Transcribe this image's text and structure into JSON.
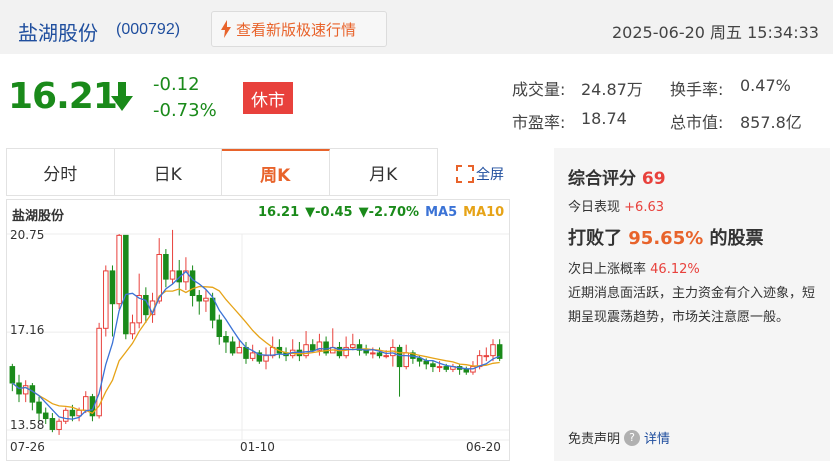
{
  "header": {
    "stock_name": "盐湖股份",
    "stock_code": "(000792)",
    "quick_button_label": "查看新版极速行情",
    "datetime": "2025-06-20 周五 15:34:33"
  },
  "quote": {
    "price": "16.21",
    "change": "-0.12",
    "change_pct": "-0.73%",
    "status": "休市",
    "trend_icon": "down-arrow-icon",
    "volume_label": "成交量:",
    "volume": "24.87万",
    "turnover_label": "换手率:",
    "turnover": "0.47%",
    "pe_label": "市盈率:",
    "pe": "18.74",
    "mcap_label": "总市值:",
    "mcap": "857.8亿"
  },
  "tabs": [
    {
      "label": "分时",
      "active": false
    },
    {
      "label": "日K",
      "active": false
    },
    {
      "label": "周K",
      "active": true
    },
    {
      "label": "月K",
      "active": false
    }
  ],
  "fullscreen_label": "全屏",
  "chart_header": {
    "name": "盐湖股份",
    "last": "16.21",
    "chg": "▼-0.45",
    "chg_pct": "▼-2.70%",
    "ma5_label": "MA5",
    "ma10_label": "MA10"
  },
  "colors": {
    "up": "#e8413c",
    "down": "#1a8a1a",
    "ma5": "#3b73d6",
    "ma10": "#e6a317",
    "accent": "#e8632b",
    "link": "#1f4e9e"
  },
  "chart_data": {
    "type": "candlestick",
    "period": "weekly",
    "ylim": [
      13.58,
      20.75
    ],
    "y_tick_labels": [
      "20.75",
      "17.16",
      "13.58"
    ],
    "x_tick_labels": [
      "07-26",
      "01-10",
      "06-20"
    ],
    "candles": [
      [
        15.9,
        15.3,
        16.0,
        15.0
      ],
      [
        15.3,
        14.9,
        15.6,
        14.6
      ],
      [
        14.9,
        15.2,
        15.4,
        14.6
      ],
      [
        15.2,
        14.6,
        15.3,
        14.3
      ],
      [
        14.6,
        14.2,
        14.8,
        13.9
      ],
      [
        14.2,
        14.0,
        14.4,
        13.8
      ],
      [
        14.0,
        13.6,
        14.2,
        13.5
      ],
      [
        13.6,
        13.9,
        14.0,
        13.4
      ],
      [
        13.9,
        14.3,
        14.4,
        13.8
      ],
      [
        14.3,
        14.1,
        14.5,
        13.9
      ],
      [
        14.1,
        14.3,
        14.4,
        13.9
      ],
      [
        14.3,
        14.8,
        15.0,
        14.2
      ],
      [
        14.8,
        14.1,
        14.9,
        13.9
      ],
      [
        14.1,
        17.3,
        17.5,
        14.0
      ],
      [
        17.3,
        19.4,
        19.6,
        17.0
      ],
      [
        19.4,
        18.2,
        19.6,
        17.0
      ],
      [
        18.2,
        20.7,
        20.75,
        18.0
      ],
      [
        20.7,
        17.1,
        20.7,
        16.9
      ],
      [
        17.1,
        17.5,
        17.8,
        16.9
      ],
      [
        17.5,
        18.5,
        19.3,
        17.3
      ],
      [
        18.5,
        17.8,
        18.8,
        17.5
      ],
      [
        17.8,
        18.3,
        18.6,
        17.5
      ],
      [
        18.3,
        20.0,
        20.6,
        18.2
      ],
      [
        20.0,
        19.1,
        20.2,
        18.8
      ],
      [
        19.1,
        19.4,
        20.9,
        18.9
      ],
      [
        19.4,
        19.0,
        19.8,
        18.5
      ],
      [
        19.0,
        19.4,
        19.9,
        18.7
      ],
      [
        19.4,
        18.5,
        19.6,
        18.1
      ],
      [
        18.5,
        18.3,
        18.7,
        17.8
      ],
      [
        18.3,
        18.4,
        18.7,
        17.9
      ],
      [
        18.4,
        17.6,
        18.6,
        17.3
      ],
      [
        17.6,
        17.0,
        17.8,
        16.7
      ],
      [
        17.0,
        16.8,
        17.2,
        16.4
      ],
      [
        16.8,
        16.4,
        17.0,
        16.3
      ],
      [
        16.4,
        16.6,
        16.9,
        16.4
      ],
      [
        16.6,
        16.2,
        16.8,
        16.0
      ],
      [
        16.2,
        16.4,
        16.7,
        16.1
      ],
      [
        16.4,
        16.1,
        16.5,
        16.0
      ],
      [
        16.1,
        16.3,
        16.6,
        15.8
      ],
      [
        16.3,
        16.6,
        17.0,
        16.2
      ],
      [
        16.6,
        16.4,
        16.9,
        16.2
      ],
      [
        16.4,
        16.3,
        16.6,
        16.1
      ],
      [
        16.3,
        16.5,
        16.9,
        16.2
      ],
      [
        16.5,
        16.3,
        16.8,
        16.1
      ],
      [
        16.3,
        16.7,
        17.2,
        16.2
      ],
      [
        16.7,
        16.5,
        16.9,
        16.4
      ],
      [
        16.5,
        16.8,
        17.1,
        16.3
      ],
      [
        16.8,
        16.4,
        17.0,
        16.3
      ],
      [
        16.4,
        16.6,
        17.3,
        16.4
      ],
      [
        16.6,
        16.3,
        16.8,
        16.2
      ],
      [
        16.3,
        16.6,
        17.0,
        16.2
      ],
      [
        16.6,
        16.7,
        17.1,
        16.5
      ],
      [
        16.7,
        16.5,
        16.9,
        16.3
      ],
      [
        16.5,
        16.4,
        16.7,
        16.3
      ],
      [
        16.4,
        16.4,
        16.6,
        16.2
      ],
      [
        16.4,
        16.3,
        16.6,
        16.2
      ],
      [
        16.3,
        16.3,
        16.5,
        16.2
      ],
      [
        16.3,
        16.6,
        16.9,
        15.9
      ],
      [
        16.6,
        15.9,
        16.7,
        14.8
      ],
      [
        15.9,
        16.4,
        16.7,
        15.8
      ],
      [
        16.4,
        16.2,
        16.5,
        16.0
      ],
      [
        16.2,
        16.1,
        16.3,
        15.9
      ],
      [
        16.1,
        16.0,
        16.2,
        15.8
      ],
      [
        16.0,
        15.9,
        16.1,
        15.7
      ],
      [
        15.9,
        15.9,
        16.1,
        15.7
      ],
      [
        15.9,
        15.8,
        16.0,
        15.7
      ],
      [
        15.8,
        15.9,
        16.0,
        15.7
      ],
      [
        15.9,
        15.8,
        16.0,
        15.6
      ],
      [
        15.8,
        15.7,
        15.9,
        15.6
      ],
      [
        15.7,
        15.9,
        16.1,
        15.6
      ],
      [
        15.9,
        16.3,
        16.5,
        15.8
      ],
      [
        16.3,
        16.3,
        16.6,
        16.1
      ],
      [
        16.3,
        16.7,
        16.9,
        16.1
      ],
      [
        16.7,
        16.2,
        16.9,
        16.1
      ]
    ]
  },
  "score_panel": {
    "title_prefix": "综合评分",
    "score": "69",
    "today_label": "今日表现",
    "today_value": "+6.63",
    "beat_prefix": "打败了",
    "beat_pct": "95.65%",
    "beat_suffix": "的股票",
    "prob_label": "次日上涨概率",
    "prob_value": "46.12%",
    "description": "近期消息面活跃，主力资金有介入迹象，短期呈现震荡趋势，市场关注意愿一般。",
    "disclaimer_label": "免责声明",
    "detail_label": "详情"
  }
}
